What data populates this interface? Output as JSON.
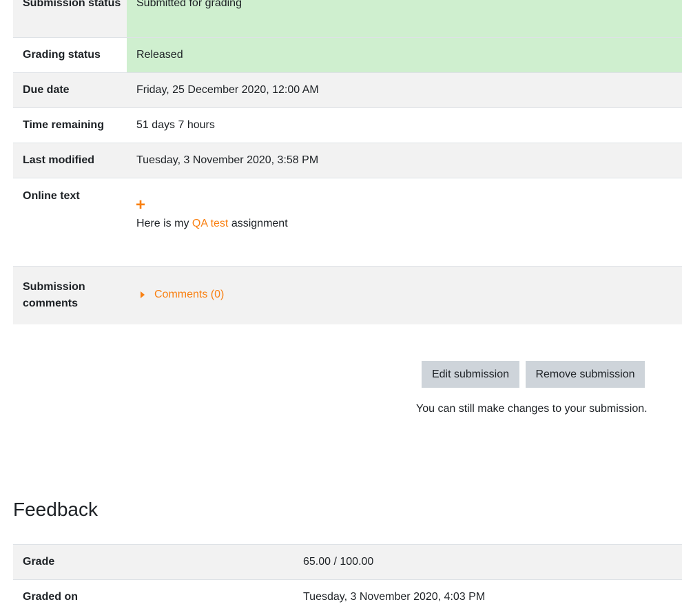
{
  "submission": {
    "status_label": "Submission status",
    "status_value": "Submitted for grading",
    "grading_label": "Grading status",
    "grading_value": "Released",
    "due_label": "Due date",
    "due_value": "Friday, 25 December 2020, 12:00 AM",
    "remaining_label": "Time remaining",
    "remaining_value": "51 days 7 hours",
    "modified_label": "Last modified",
    "modified_value": "Tuesday, 3 November 2020, 3:58 PM",
    "online_label": "Online text",
    "online_text_before": "Here is my",
    "online_text_link": "QA test",
    "online_text_after": "assignment",
    "comments_label": "Submission comments",
    "comments_link": "Comments (0)",
    "highlight_color": "#cfefcf"
  },
  "actions": {
    "edit_label": "Edit submission",
    "remove_label": "Remove submission",
    "note": "You can still make changes to your submission."
  },
  "feedback": {
    "heading": "Feedback",
    "grade_label": "Grade",
    "grade_value": "65.00 / 100.00",
    "graded_on_label": "Graded on",
    "graded_on_value": "Tuesday, 3 November 2020, 4:03 PM"
  },
  "colors": {
    "accent": "#f98012",
    "row_grey": "#f2f2f2",
    "button_bg": "#ced4da"
  },
  "icons": {
    "expand": "plus-icon",
    "collapse_toggle": "caret-right-icon"
  }
}
